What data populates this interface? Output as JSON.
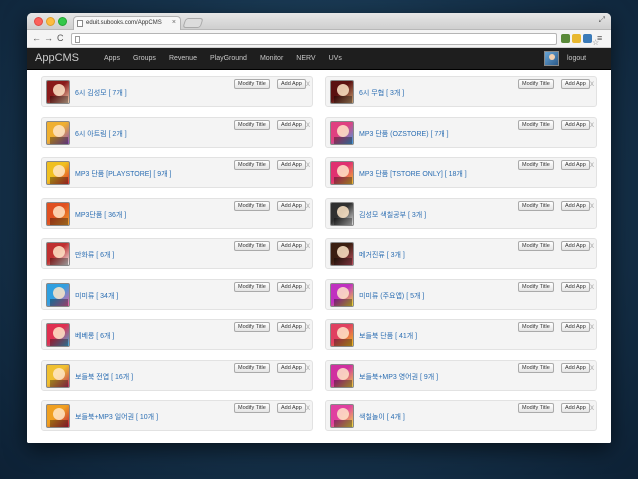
{
  "browser": {
    "tab_title": "eduit.subooks.com/AppCMS",
    "tab_close": "×",
    "back_glyph": "←",
    "forward_glyph": "→",
    "reload_glyph": "C",
    "star_glyph": "☆",
    "menu_glyph": "≡",
    "fullscreen_glyph": "⤢",
    "extension_colors": [
      "#5a8a3a",
      "#e8b830",
      "#3a7ab8",
      "#2a6ac8",
      "#6a6a6a"
    ]
  },
  "app": {
    "brand": "AppCMS",
    "menu": [
      "Apps",
      "Groups",
      "Revenue",
      "PlayGround",
      "Monitor",
      "NERV",
      "UVs"
    ],
    "logout": "logout"
  },
  "labels": {
    "modify": "Modify Title",
    "add": "Add App",
    "close": "x"
  },
  "cards": [
    {
      "title": "6시 김성모 [ 7개 ]",
      "colors": [
        "#8a1a1a",
        "#f0d0b0"
      ]
    },
    {
      "title": "6시 무협 [ 3개 ]",
      "colors": [
        "#5a1010",
        "#c8a070"
      ]
    },
    {
      "title": "6시 아트림 [ 2개 ]",
      "colors": [
        "#f0b030",
        "#8a50c0"
      ]
    },
    {
      "title": "MP3 단품 (OZSTORE) [ 7개 ]",
      "colors": [
        "#e04080",
        "#40a0e0"
      ]
    },
    {
      "title": "MP3 단품 [PLAYSTORE] [ 9개 ]",
      "colors": [
        "#f0c020",
        "#e03030"
      ]
    },
    {
      "title": "MP3 단품 [TSTORE ONLY] [ 18개 ]",
      "colors": [
        "#e03070",
        "#f0c030"
      ]
    },
    {
      "title": "MP3단품 [ 36개 ]",
      "colors": [
        "#e05020",
        "#f0a030"
      ]
    },
    {
      "title": "김성모 색칠공부 [ 3개 ]",
      "colors": [
        "#303030",
        "#e0e0e0"
      ]
    },
    {
      "title": "만화류 [ 6개 ]",
      "colors": [
        "#c03030",
        "#f0f0f0"
      ]
    },
    {
      "title": "메거진류 [ 3개 ]",
      "colors": [
        "#3a1e10",
        "#c05060"
      ]
    },
    {
      "title": "미미류 [ 34개 ]",
      "colors": [
        "#30a0e0",
        "#f060a0"
      ]
    },
    {
      "title": "미미류 (주요앱) [ 5개 ]",
      "colors": [
        "#c030c0",
        "#f0e030"
      ]
    },
    {
      "title": "베베롱 [ 6개 ]",
      "colors": [
        "#e03050",
        "#40b0e0"
      ]
    },
    {
      "title": "보들북 단품 [ 41개 ]",
      "colors": [
        "#e04060",
        "#f0c020"
      ]
    },
    {
      "title": "보들북 전엽 [ 16개 ]",
      "colors": [
        "#f0c030",
        "#c03060"
      ]
    },
    {
      "title": "보들북+MP3 영어권 [ 9개 ]",
      "colors": [
        "#d030a0",
        "#f0d040"
      ]
    },
    {
      "title": "보들북+MP3 일어권 [ 10개 ]",
      "colors": [
        "#f0a020",
        "#c02040"
      ]
    },
    {
      "title": "색칠놀이 [ 4개 ]",
      "colors": [
        "#e040a0",
        "#f0e040"
      ]
    }
  ]
}
